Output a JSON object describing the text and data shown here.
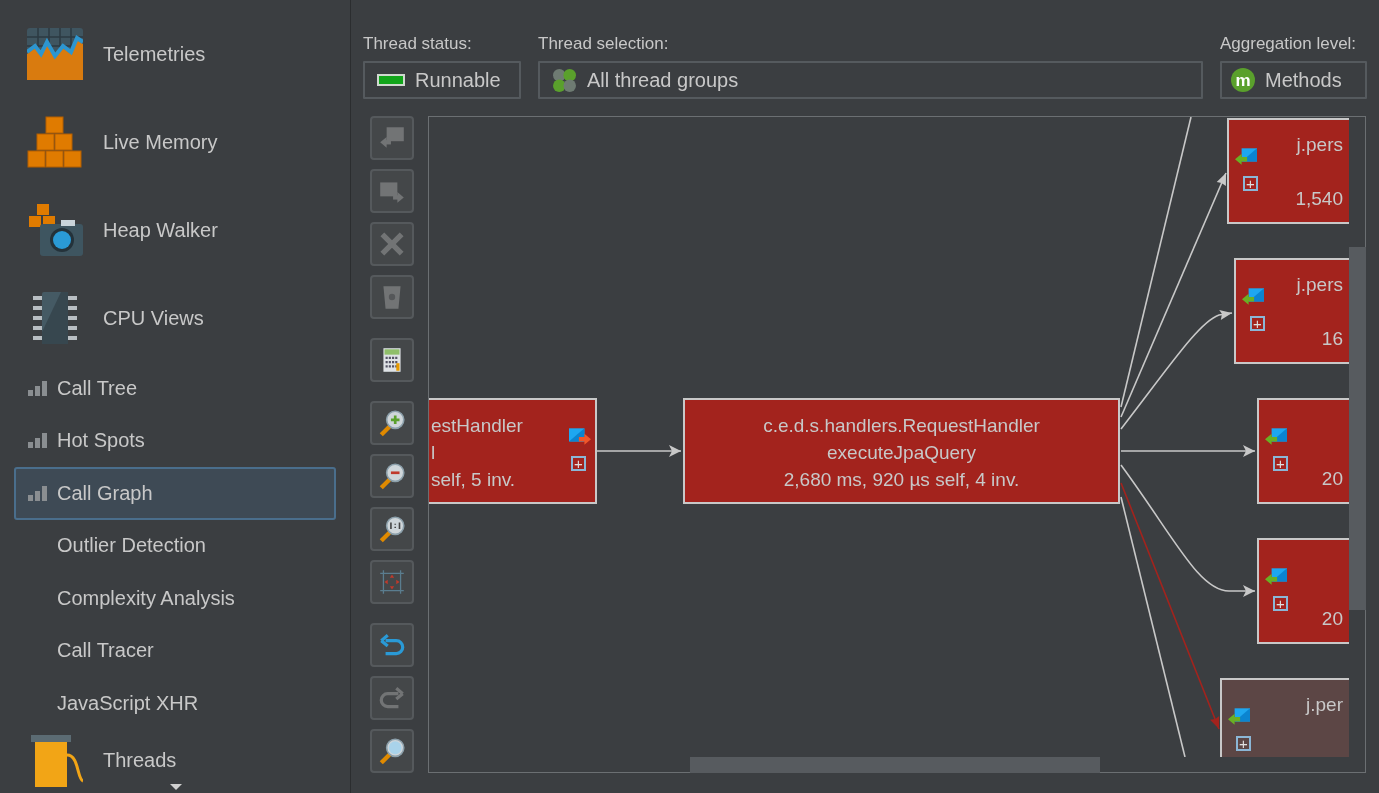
{
  "sidebar": {
    "items": [
      {
        "label": "Telemetries",
        "kind": "section",
        "selected": false
      },
      {
        "label": "Live Memory",
        "kind": "section",
        "selected": false
      },
      {
        "label": "Heap Walker",
        "kind": "section",
        "selected": false
      },
      {
        "label": "CPU Views",
        "kind": "section",
        "selected": false
      },
      {
        "label": "Call Tree",
        "kind": "view",
        "selected": false
      },
      {
        "label": "Hot Spots",
        "kind": "view",
        "selected": false
      },
      {
        "label": "Call Graph",
        "kind": "view",
        "selected": true
      },
      {
        "label": "Outlier Detection",
        "kind": "subview",
        "selected": false
      },
      {
        "label": "Complexity Analysis",
        "kind": "subview",
        "selected": false
      },
      {
        "label": "Call Tracer",
        "kind": "subview",
        "selected": false
      },
      {
        "label": "JavaScript XHR",
        "kind": "subview",
        "selected": false
      },
      {
        "label": "Threads",
        "kind": "section",
        "selected": false
      }
    ]
  },
  "filters": {
    "thread_status": {
      "label": "Thread status:",
      "value": "Runnable"
    },
    "thread_selection": {
      "label": "Thread selection:",
      "value": "All thread groups"
    },
    "aggregation": {
      "label": "Aggregation level:",
      "value": "Methods",
      "badge": "m"
    }
  },
  "graph_toolbar": [
    {
      "kind": "back",
      "disabled": true
    },
    {
      "kind": "forward",
      "disabled": true
    },
    {
      "kind": "delete",
      "disabled": true
    },
    {
      "kind": "trash",
      "disabled": true
    },
    {
      "kind": "calculator",
      "disabled": false
    },
    {
      "kind": "zoom-in",
      "disabled": false
    },
    {
      "kind": "zoom-out",
      "disabled": false
    },
    {
      "kind": "zoom-reset",
      "disabled": false
    },
    {
      "kind": "fit",
      "disabled": false
    },
    {
      "kind": "undo",
      "disabled": false
    },
    {
      "kind": "redo",
      "disabled": true
    },
    {
      "kind": "find",
      "disabled": false
    }
  ],
  "graph": {
    "nodes": [
      {
        "kind": "caller",
        "color": "#a3231d",
        "lines": [
          "estHandler",
          "l",
          "self, 5 inv."
        ],
        "expander": "+"
      },
      {
        "kind": "current",
        "color": "#a3231d",
        "lines": [
          "c.e.d.s.handlers.RequestHandler",
          "executeJpaQuery",
          "2,680 ms, 920 µs self, 4 inv."
        ]
      },
      {
        "kind": "callee",
        "color": "#a3231d",
        "name": "j.pers",
        "count": "1,540",
        "expander": "+"
      },
      {
        "kind": "callee",
        "color": "#a3231d",
        "name": "j.pers",
        "count": "16",
        "expander": "+"
      },
      {
        "kind": "callee",
        "color": "#a3231d",
        "count": "20",
        "expander": "+"
      },
      {
        "kind": "callee",
        "color": "#a3231d",
        "count": "20",
        "expander": "+"
      },
      {
        "kind": "callee",
        "color": "#5c4645",
        "name": "j.per",
        "expander": "+"
      }
    ],
    "edges": [
      {
        "highlighted": false
      },
      {
        "highlighted": false
      },
      {
        "highlighted": false
      },
      {
        "highlighted": false
      },
      {
        "highlighted": false
      },
      {
        "highlighted": false
      },
      {
        "highlighted": true
      },
      {
        "highlighted": false
      }
    ]
  }
}
